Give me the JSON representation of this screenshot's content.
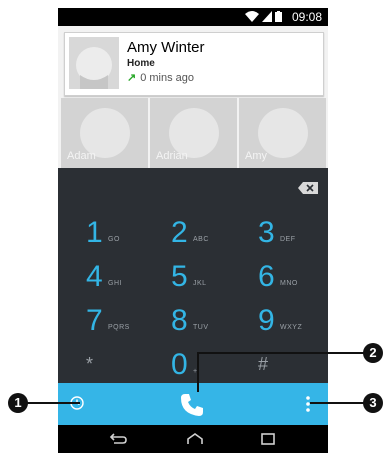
{
  "status_bar": {
    "time": "09:08"
  },
  "recent_call": {
    "name": "Amy Winter",
    "type": "Home",
    "when": "0 mins ago"
  },
  "favorites": [
    {
      "name": "Adam"
    },
    {
      "name": "Adrian"
    },
    {
      "name": "Amy"
    }
  ],
  "dialpad": {
    "keys": [
      {
        "digit": "1",
        "letters": "GO"
      },
      {
        "digit": "2",
        "letters": "ABC"
      },
      {
        "digit": "3",
        "letters": "DEF"
      },
      {
        "digit": "4",
        "letters": "GHI"
      },
      {
        "digit": "5",
        "letters": "JKL"
      },
      {
        "digit": "6",
        "letters": "MNO"
      },
      {
        "digit": "7",
        "letters": "PQRS"
      },
      {
        "digit": "8",
        "letters": "TUV"
      },
      {
        "digit": "9",
        "letters": "WXYZ"
      },
      {
        "digit": "*",
        "letters": ""
      },
      {
        "digit": "0",
        "letters": "+"
      },
      {
        "digit": "#",
        "letters": ""
      }
    ]
  },
  "callouts": {
    "history": "1",
    "call": "2",
    "menu": "3"
  },
  "icons": [
    "wifi-icon",
    "signal-icon",
    "battery-icon",
    "backspace-icon",
    "history-icon",
    "call-icon",
    "overflow-menu-icon",
    "back-icon",
    "home-icon",
    "recents-icon"
  ],
  "colors": {
    "accent": "#35b5e7",
    "digits": "#33b5e5",
    "dialpad_bg": "#2b2f34"
  }
}
